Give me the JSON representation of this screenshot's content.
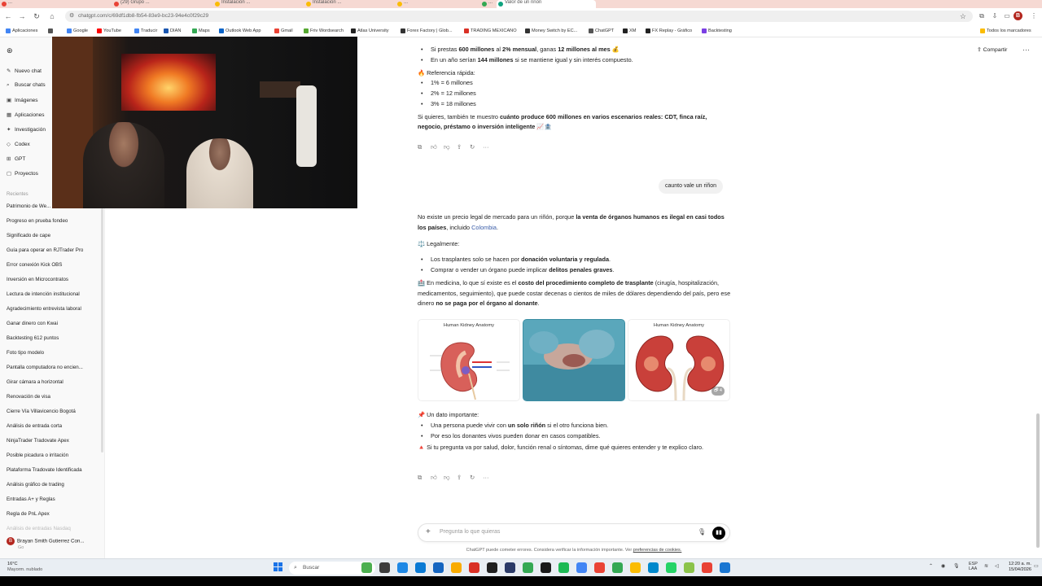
{
  "browser": {
    "tabs": [
      {
        "label": "...",
        "color": "#e94235"
      },
      {
        "label": "(29) Grupo ...",
        "color": "#e94235"
      },
      {
        "label": "Instalación ...",
        "color": "#fbbc04"
      },
      {
        "label": "Instalación ...",
        "color": "#fbbc04"
      },
      {
        "label": "...",
        "color": "#fbbc04"
      },
      {
        "label": "...",
        "color": "#34a853"
      },
      {
        "label": "Valor de un riñón",
        "color": "#10a37f"
      }
    ],
    "url": "chatgpt.com/c/69df1db8-fb54-83e9-bc23-94e4c0f29c29",
    "profile_initial": "B",
    "bookmarks": [
      {
        "label": "Aplicaciones",
        "color": "#4285f4"
      },
      {
        "label": "",
        "color": "#555555"
      },
      {
        "label": "Google",
        "color": "#4285f4"
      },
      {
        "label": "YouTube",
        "color": "#ff0000"
      },
      {
        "label": "Traducir",
        "color": "#4285f4"
      },
      {
        "label": "DIAN",
        "color": "#1a56b0"
      },
      {
        "label": "Maps",
        "color": "#34a853"
      },
      {
        "label": "Outlook Web App",
        "color": "#0a64c8"
      },
      {
        "label": "Gmail",
        "color": "#ea4335"
      },
      {
        "label": "Friv Wordsearch",
        "color": "#56a832"
      },
      {
        "label": "Atlas University",
        "color": "#222222"
      },
      {
        "label": "Forex Factory | Glob...",
        "color": "#333333"
      },
      {
        "label": "TRADING MEXICANO",
        "color": "#d93025"
      },
      {
        "label": "Money Switch by EC...",
        "color": "#333333"
      },
      {
        "label": "ChatGPT",
        "color": "#555555"
      },
      {
        "label": "XM",
        "color": "#222222"
      },
      {
        "label": "FX Replay - Gráfico",
        "color": "#222222"
      },
      {
        "label": "Backtesting",
        "color": "#7b3fe4"
      }
    ],
    "all_bookmarks": "Todos los marcadores"
  },
  "sidebar": {
    "nav": [
      {
        "icon": "✎",
        "label": "Nuevo chat"
      },
      {
        "icon": "⌕",
        "label": "Buscar chats"
      },
      {
        "icon": "▣",
        "label": "Imágenes"
      },
      {
        "icon": "▦",
        "label": "Aplicaciones"
      },
      {
        "icon": "✦",
        "label": "Investigación"
      },
      {
        "icon": "◇",
        "label": "Codex"
      },
      {
        "icon": "⊞",
        "label": "GPT"
      },
      {
        "icon": "▢",
        "label": "Proyectos"
      }
    ],
    "section_label": "Recientes",
    "chats": [
      "Patrimonio de We...",
      "Progreso en prueba fondeo",
      "Significado de cape",
      "Guía para operar en RJTrader Pro",
      "Error conexión Kick OBS",
      "Inversión en Microcontratos",
      "Lectura de intención institucional",
      "Agradecimiento entrevista laboral",
      "Ganar dinero con Kwai",
      "Backtesting 612 puntos",
      "Foto tipo modelo",
      "Pantalla computadora no encien...",
      "Girar cámara a horizontal",
      "Renovación de visa",
      "Cierre Vía Villavicencio Bogotá",
      "Análisis de entrada corta",
      "NinjaTrader Tradovate Apex",
      "Posible picadura o irritación",
      "Plataforma Tradovate Identificada",
      "Análisis gráfico de trading",
      "Entradas A+ y Reglas",
      "Regla de PnL Apex",
      "Análisis de entradas Nasdaq"
    ],
    "user_initial": "B",
    "user_name": "Brayan Smith Gutierrez Con...",
    "user_plan": "Go"
  },
  "header": {
    "share_label": "Compartir",
    "more": "···"
  },
  "conversation": {
    "prev_bullets": [
      [
        "Si prestas ",
        "600 millones",
        " al ",
        "2% mensual",
        ", ganas ",
        "12 millones al mes",
        " 💰"
      ],
      [
        "En un año serían ",
        "144 millones",
        " si se mantiene igual y sin interés compuesto.",
        "",
        "",
        "",
        ""
      ]
    ],
    "quick_ref_title": "🔥 Referencia rápida:",
    "quick_ref": [
      "1% = 6 millones",
      "2% = 12 millones",
      "3% = 18 millones"
    ],
    "prev_closing_a": "Si quieres, también te muestro ",
    "prev_closing_b": "cuánto produce 600 millones en varios escenarios reales: CDT, finca raíz, negocio, préstamo o inversión inteligente",
    "prev_closing_c": " 📈🏦",
    "user_message": "caunto vale un riñon",
    "answer_intro_a": "No existe un precio legal de mercado para un riñón, porque ",
    "answer_intro_b": "la venta de órganos humanos es ilegal en casi todos los países",
    "answer_intro_c": ", incluido ",
    "answer_intro_link": "Colombia",
    "answer_intro_d": ".",
    "legal_title": "⚖️ Legalmente:",
    "legal_bullets": [
      {
        "a": "Los trasplantes solo se hacen por ",
        "b": "donación voluntaria y regulada",
        "c": "."
      },
      {
        "a": "Comprar o vender un órgano puede implicar ",
        "b": "delitos penales graves",
        "c": "."
      }
    ],
    "medicine_a": "🏥 En medicina, lo que sí existe es el ",
    "medicine_b": "costo del procedimiento completo de trasplante",
    "medicine_c": " (cirugía, hospitalización, medicamentos, seguimiento), que puede costar decenas o cientos de miles de dólares dependiendo del país, pero ese dinero ",
    "medicine_d": "no se paga por el órgano al donante",
    "medicine_e": ".",
    "images": [
      {
        "caption": "Human Kidney Anatomy"
      },
      {
        "caption": ""
      },
      {
        "caption": "Human Kidney Anatomy",
        "badge": "🗗 4"
      }
    ],
    "fact_title": "📌 Un dato importante:",
    "fact_bullets": [
      {
        "a": "Una persona puede vivir con ",
        "b": "un solo riñón",
        "c": " si el otro funciona bien."
      },
      {
        "a": "Por eso los donantes vivos pueden donar en casos compatibles.",
        "b": "",
        "c": ""
      }
    ],
    "closing": "🔺 Si tu pregunta va por salud, dolor, función renal o síntomas, dime qué quieres entender y te explico claro."
  },
  "composer": {
    "placeholder": "Pregunta lo que quieras",
    "disclaimer": "ChatGPT puede cometer errores. Considera verificar la información importante. Ver",
    "disclaimer_link": "preferencias de cookies."
  },
  "taskbar": {
    "weather_temp": "16°C",
    "weather_desc": "Mayorm. nublado",
    "search_label": "Buscar",
    "tray_lang_a": "ESP",
    "tray_lang_b": "LAA",
    "time": "12:20 a. m.",
    "date": "15/04/2026"
  }
}
